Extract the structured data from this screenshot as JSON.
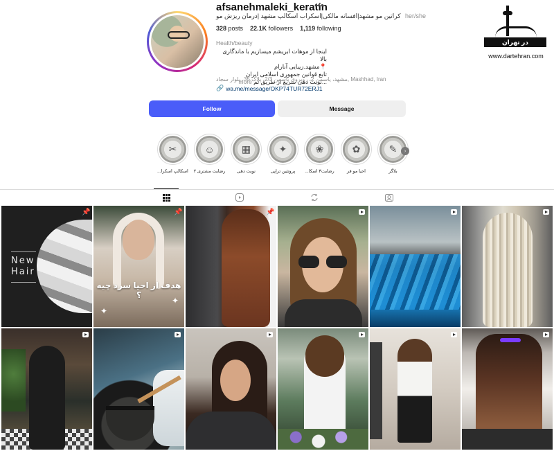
{
  "profile": {
    "username": "afsanehmaleki_keratin",
    "more_icon": "•••",
    "full_name": "کراتین مو مشهد|افسانه مالکی|اسکراب اسکالپ مشهد |درمان ریزش مو",
    "pronouns": "her/she",
    "stats": {
      "posts_count": "328",
      "posts_label": "posts",
      "followers_count": "22.1K",
      "followers_label": "followers",
      "following_count": "1,119",
      "following_label": "following"
    },
    "category": "Health/beauty",
    "bio_lines": [
      "اینجا از موهات ابریشم میسازیم با ماندگاری بالا",
      "📍مشهد.زیبایی آنارام",
      "تابع قوانین جمهوری اسلامی ایران",
      "...نوبت دهی سریع از طریق تم"
    ],
    "bio_more": "more",
    "address": "مشهد، یاسمن 2، روبروی یاسمن 2/3، پلاک 35، بلوار سجاد, Mashhad, Iran",
    "link_text": "wa.me/message/OKP74TUR72ERJ1",
    "link_icon": "link-icon"
  },
  "actions": {
    "follow_label": "Follow",
    "message_label": "Message",
    "accent_color": "#4a5df9"
  },
  "watermark": {
    "band_text": "در تهران",
    "url": "www.dartehran.com"
  },
  "highlights": [
    {
      "label": "بلاگر",
      "has_badge": true
    },
    {
      "label": "احیا مو فر"
    },
    {
      "label": "رضایت۳ اسکا..."
    },
    {
      "label": "پروتئین تراپی"
    },
    {
      "label": "نوبت دهی"
    },
    {
      "label": "رضایت مشتری ۲"
    },
    {
      "label": "اسکالپ اسکرا..."
    }
  ],
  "tabs": [
    {
      "name": "posts",
      "icon": "grid-icon",
      "active": true
    },
    {
      "name": "reels",
      "icon": "reels-icon"
    },
    {
      "name": "reposts",
      "icon": "repost-icon"
    },
    {
      "name": "tagged",
      "icon": "tagged-icon"
    }
  ],
  "grid": {
    "tile1_text_line1": "New",
    "tile1_text_line2": "Hair",
    "tile2_caption": "هدف از احیا سرد چیه ؟",
    "tiles": [
      {
        "badge": "pin"
      },
      {
        "badge": "pin"
      },
      {
        "badge": "pin"
      },
      {
        "badge": "reel"
      },
      {
        "badge": "reel"
      },
      {
        "badge": "reel"
      },
      {
        "badge": "reel"
      },
      {
        "badge": "reel"
      },
      {
        "badge": "reel"
      },
      {
        "badge": "reel"
      },
      {
        "badge": "reel"
      },
      {
        "badge": "reel"
      }
    ]
  }
}
